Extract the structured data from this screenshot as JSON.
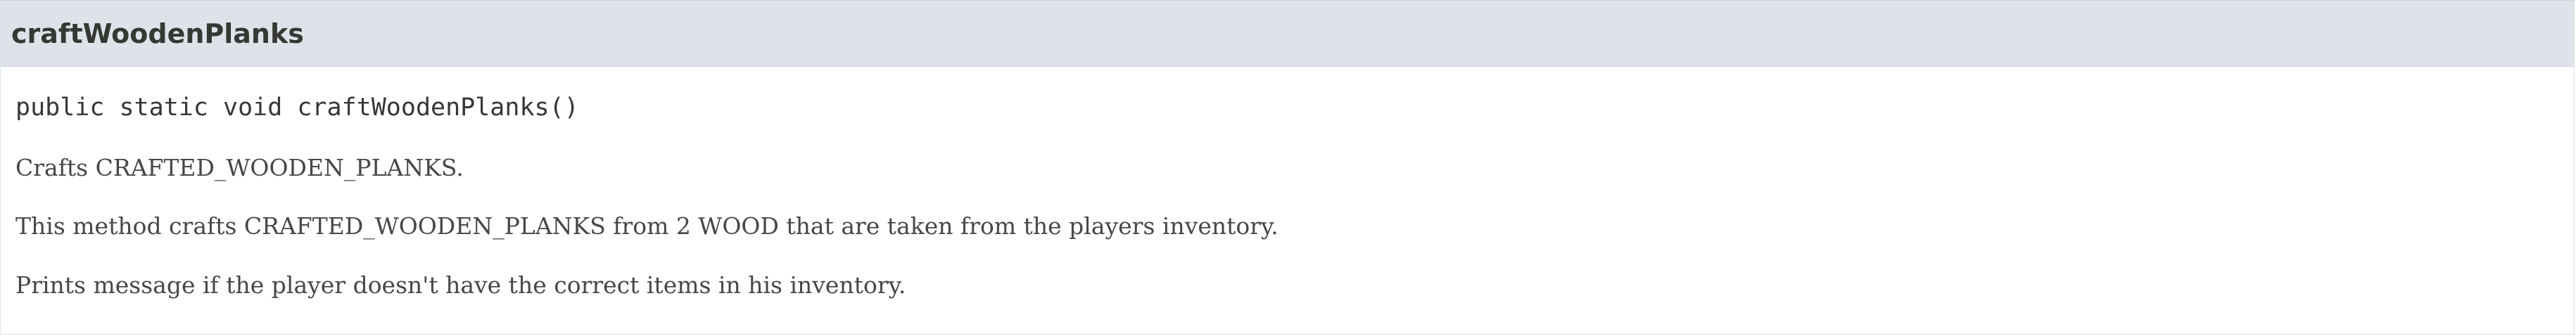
{
  "member": {
    "name": "craftWoodenPlanks",
    "signature": "public static void craftWoodenPlanks()",
    "description": [
      "Crafts CRAFTED_WOODEN_PLANKS.",
      "This method crafts CRAFTED_WOODEN_PLANKS from 2 WOOD that are taken from the players inventory.",
      "Prints message if the player doesn't have the correct items in his inventory."
    ]
  },
  "colors": {
    "header_background": "#dee3e9",
    "text": "#353833",
    "body_text": "#474747"
  }
}
